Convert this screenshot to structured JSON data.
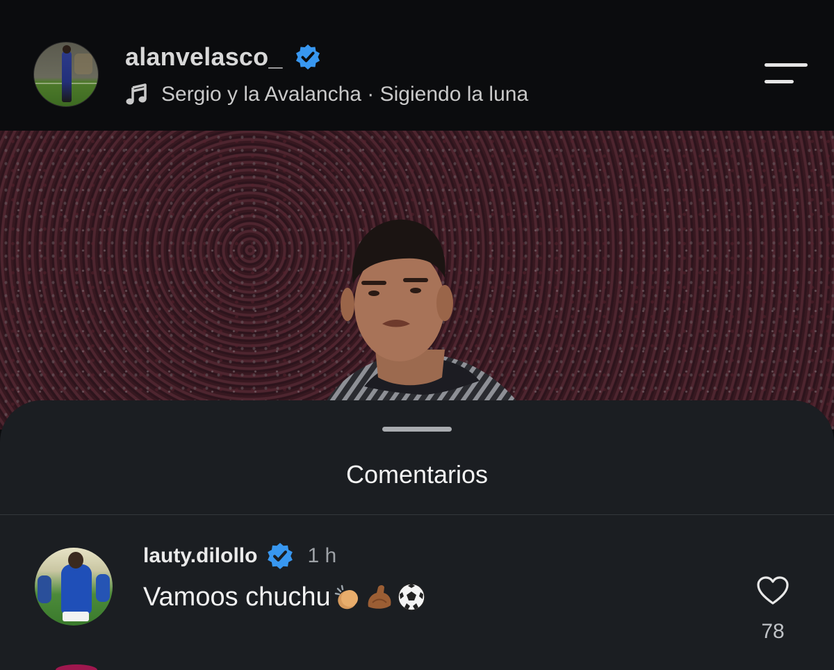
{
  "header": {
    "username": "alanvelasco_",
    "song": "Sergio y la Avalancha · Sigiendo la luna",
    "icons": {
      "verified": "verified-badge-icon",
      "music": "music-note-icon",
      "menu": "menu-icon"
    }
  },
  "post": {
    "image": "player-photo"
  },
  "comments_sheet": {
    "title": "Comentarios",
    "comments": [
      {
        "username": "lauty.dilollo",
        "verified": true,
        "time": "1 h",
        "text": "Vamoos chuchu",
        "emojis": [
          "clapping-hands-emoji",
          "flexed-biceps-emoji",
          "soccer-ball-emoji"
        ],
        "likes": "78"
      }
    ]
  },
  "colors": {
    "background": "#0b0c0e",
    "sheet": "#1b1e22",
    "verified_blue": "#3897f0",
    "muted_text": "#9ea2a7"
  }
}
